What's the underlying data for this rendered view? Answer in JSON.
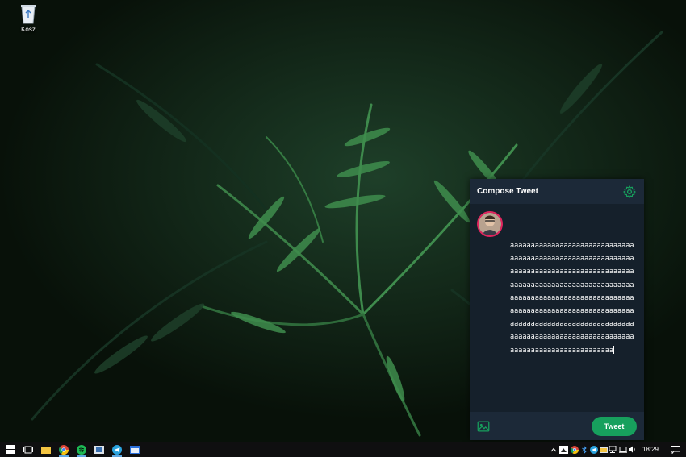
{
  "desktop": {
    "icons": [
      {
        "label": "Kosz",
        "icon": "recycle-bin-icon"
      }
    ]
  },
  "compose": {
    "title": "Compose Tweet",
    "settings_icon": "gear-icon",
    "avatar_icon": "user-avatar",
    "text": "aaaaaaaaaaaaaaaaaaaaaaaaaaaaaaaaaaaaaaaaaaaaaaaaaaaaaaaaaaaaaaaaaaaaaaaaaaaaaaaaaaaaaaaaaaaaaaaaaaaaaaaaaaaaaaaaaaaaaaaaaaaaaaaaaaaaaaaaaaaaaaaaaaaaaaaaaaaaaaaaaaaaaaaaaaaaaaaaaaaaaaaaaaaaaaaaaaaaaaaaaaaaaaaaaaaaaaaaaaaaaaaaaaaaaaaaaaaaaaaaaaaaaaaaaaaaaaaaaaaaaaaaa",
    "image_icon": "image-icon",
    "tweet_label": "Tweet",
    "accent_color": "#17a05d"
  },
  "taskbar": {
    "apps": [
      "windows-start-icon",
      "task-view-icon",
      "file-explorer-icon",
      "chrome-icon",
      "spotify-icon",
      "photos-icon",
      "telegram-icon",
      "app-window-icon"
    ],
    "tray": [
      "chevron-up-icon",
      "tweet-app-tray-icon",
      "chrome-tray-icon",
      "bluetooth-icon",
      "telegram-tray-icon",
      "folder-tray-icon",
      "network-icon",
      "laptop-icon",
      "volume-icon"
    ],
    "clock": "18:29"
  }
}
